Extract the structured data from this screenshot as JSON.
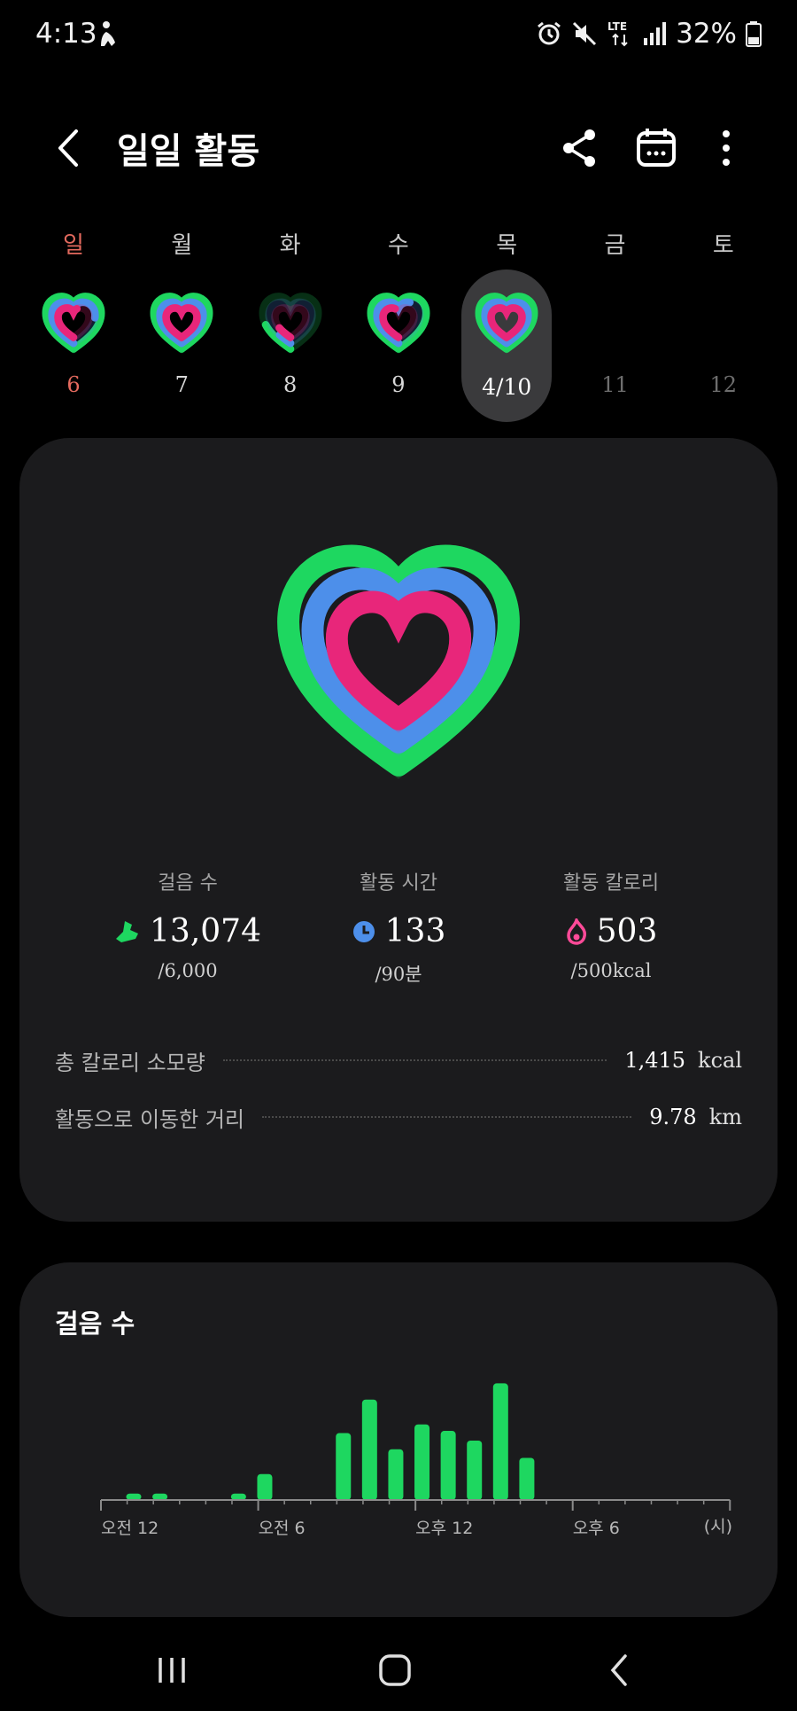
{
  "status_bar": {
    "time": "4:13",
    "battery": "32%",
    "left_icons": [
      "accessibility-icon"
    ],
    "right_icons": [
      "alarm-icon",
      "mute-icon",
      "lte-icon",
      "signal-icon",
      "battery-icon"
    ],
    "network": "LTE"
  },
  "header": {
    "title": "일일 활동",
    "icons": [
      "back-icon",
      "share-icon",
      "calendar-icon",
      "more-icon"
    ]
  },
  "week": [
    {
      "name": "일",
      "date": "6",
      "ring": {
        "steps": 1.0,
        "active": 0.75,
        "calories": 0.55
      }
    },
    {
      "name": "월",
      "date": "7",
      "ring": {
        "steps": 1.0,
        "active": 1.0,
        "calories": 1.0
      }
    },
    {
      "name": "화",
      "date": "8",
      "ring": {
        "steps": 0.2,
        "active": 0.1,
        "calories": 0.15
      }
    },
    {
      "name": "수",
      "date": "9",
      "ring": {
        "steps": 1.0,
        "active": 0.6,
        "calories": 0.45
      }
    },
    {
      "name": "목",
      "date": "4/10",
      "selected": true,
      "ring": {
        "steps": 1.0,
        "active": 1.0,
        "calories": 1.0
      }
    },
    {
      "name": "금",
      "date": "11"
    },
    {
      "name": "토",
      "date": "12"
    }
  ],
  "stats": {
    "steps": {
      "label": "걸음 수",
      "value": "13,074",
      "goal": "/6,000",
      "icon": "shoe-icon"
    },
    "active_time": {
      "label": "활동 시간",
      "value": "133",
      "goal": "/90분",
      "icon": "clock-icon"
    },
    "active_calories": {
      "label": "활동 칼로리",
      "value": "503",
      "goal": "/500kcal",
      "icon": "flame-icon"
    }
  },
  "summary": [
    {
      "label": "총 칼로리 소모량",
      "value": "1,415",
      "unit": "kcal"
    },
    {
      "label": "활동으로 이동한 거리",
      "value": "9.78",
      "unit": "km"
    }
  ],
  "steps_card": {
    "title": "걸음 수"
  },
  "colors": {
    "steps": "#1ed760",
    "active": "#4d8fea",
    "calories": "#e8267a",
    "sunday": "#e46a5e",
    "card": "#1b1b1d"
  },
  "chart_data": {
    "type": "bar",
    "xlabel": "(시)",
    "x_ticks": [
      "오전 12",
      "오전 6",
      "오후 12",
      "오후 6"
    ],
    "x_tick_hours": [
      0,
      6,
      12,
      18
    ],
    "xlim": [
      0,
      24
    ],
    "ylim": [
      0,
      110
    ],
    "bars": [
      {
        "hour": 1.25,
        "value": 6
      },
      {
        "hour": 2.25,
        "value": 6
      },
      {
        "hour": 5.25,
        "value": 6
      },
      {
        "hour": 6.25,
        "value": 24
      },
      {
        "hour": 9.25,
        "value": 62
      },
      {
        "hour": 10.25,
        "value": 93
      },
      {
        "hour": 11.25,
        "value": 47
      },
      {
        "hour": 12.25,
        "value": 70
      },
      {
        "hour": 13.25,
        "value": 64
      },
      {
        "hour": 14.25,
        "value": 55
      },
      {
        "hour": 15.25,
        "value": 108
      },
      {
        "hour": 16.25,
        "value": 39
      }
    ],
    "bar_color": "#1ed760"
  },
  "navbar": {
    "icons": [
      "recent-apps-icon",
      "home-icon",
      "back-nav-icon"
    ]
  }
}
